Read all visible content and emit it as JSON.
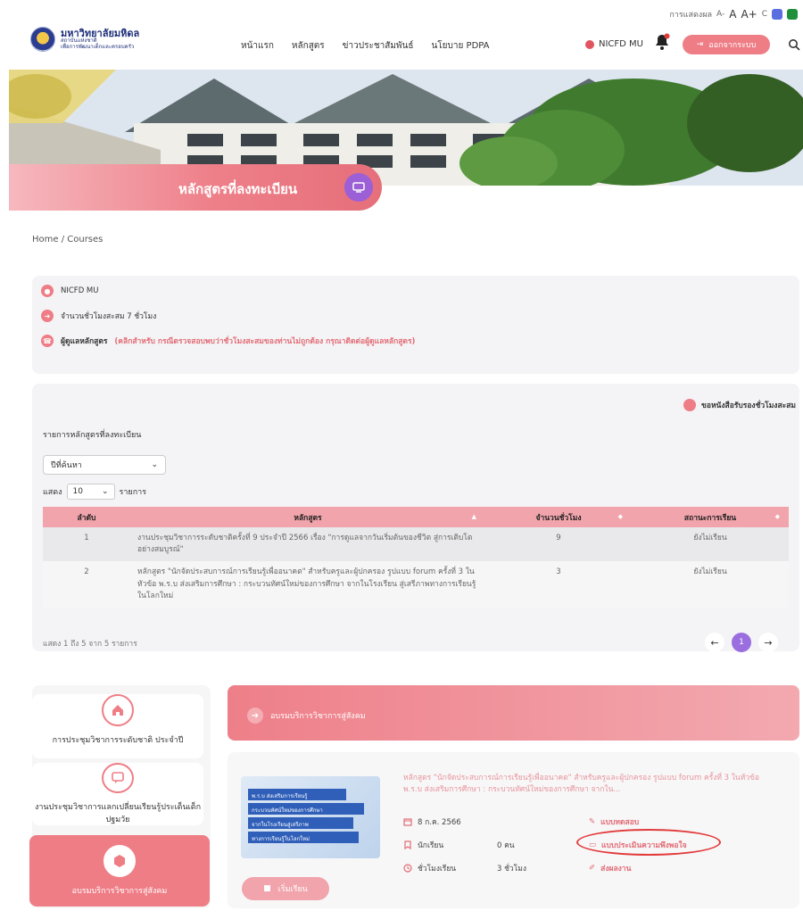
{
  "header": {
    "a11y": {
      "font_size_label": "การแสดงผล",
      "font_small": "A-",
      "font_normal": "A",
      "font_large": "A+",
      "contrast": "C"
    },
    "logo": {
      "main": "มหาวิทยาลัยมหิดล",
      "line1": "สถาบันแห่งชาติ",
      "line2": "เพื่อการพัฒนาเด็กและครอบครัว"
    },
    "nav": [
      "หน้าแรก",
      "หลักสูตร",
      "ข่าวประชาสัมพันธ์",
      "นโยบาย PDPA"
    ],
    "user": "NICFD MU",
    "logout": "ออกจากระบบ"
  },
  "banner": {
    "title": "หลักสูตรที่ลงทะเบียน"
  },
  "breadcrumb": "Home / Courses",
  "info": {
    "name": "NICFD MU",
    "hours": "จำนวนชั่วโมงสะสม 7 ชั่วโมง",
    "admin_label": "ผู้ดูแลหลักสูตร",
    "admin_note": "(คลิกสำหรับ กรณีตรวจสอบพบว่าชั่วโมงสะสมของท่านไม่ถูกต้อง กรุณาติดต่อผู้ดูแลหลักสูตร)"
  },
  "courses": {
    "cert_link": "ขอหนังสือรับรองชั่วโมงสะสม",
    "list_title": "รายการหลักสูตรที่ลงทะเบียน",
    "year_select": "ปีที่ค้นหา",
    "show_label": "แสดง",
    "show_value": "10",
    "show_suffix": "รายการ",
    "columns": [
      "ลำดับ",
      "หลักสูตร",
      "จำนวนชั่วโมง",
      "สถานะการเรียน"
    ],
    "rows": [
      {
        "no": "1",
        "title": "งานประชุมวิชาการระดับชาติครั้งที่ 9 ประจำปี 2566 เรื่อง \"การดูแลจากวันเริ่มต้นของชีวิต สู่การเติบโตอย่างสมบูรณ์\"",
        "hours": "9",
        "status": "ยังไม่เรียน"
      },
      {
        "no": "2",
        "title": "หลักสูตร \"นักจัดประสบการณ์การเรียนรู้เพื่ออนาคต\" สำหรับครูและผู้ปกครอง รูปแบบ forum ครั้งที่ 3 ในหัวข้อ พ.ร.บ ส่งเสริมการศึกษา : กระบวนทัศน์ใหม่ของการศึกษา จากในโรงเรียน สู่เสรีภาพทางการเรียนรู้ในโลกใหม่",
        "hours": "3",
        "status": "ยังไม่เรียน"
      }
    ],
    "summary": "แสดง 1 ถึง 5 จาก 5 รายการ",
    "page": "1"
  },
  "categories": [
    {
      "label": "การประชุมวิชาการระดับชาติ ประจำปี",
      "icon": "home-icon"
    },
    {
      "label": "งานประชุมวิชาการแลกเปลี่ยนเรียนรู้ประเด็นเด็กปฐมวัย",
      "icon": "chat-icon"
    },
    {
      "label": "อบรมบริการวิชาการสู่สังคม",
      "icon": "box-icon"
    }
  ],
  "section": {
    "title": "อบรมบริการวิชาการสู่สังคม"
  },
  "course_card": {
    "thumb_lines": [
      "พ.ร.บ ส่งเสริมการเรียนรู้",
      "กระบวนทัศน์ใหม่ของการศึกษา",
      "จากในโรงเรียนสู่เสรีภาพ",
      "ทางการเรียนรู้ในโลกใหม่"
    ],
    "description": "หลักสูตร \"นักจัดประสบการณ์การเรียนรู้เพื่ออนาคต\" สำหรับครูและผู้ปกครอง รูปแบบ forum ครั้งที่ 3 ในหัวข้อ พ.ร.บ ส่งเสริมการศึกษา : กระบวนทัศน์ใหม่ของการศึกษา จากใน...",
    "date": "8 ก.ค. 2566",
    "learners_label": "นักเรียน",
    "learners_value": "0 คน",
    "hours_label": "ชั่วโมงเรียน",
    "hours_value": "3 ชั่วโมง",
    "test": "แบบทดสอบ",
    "survey": "แบบประเมินความพึงพอใจ",
    "submit": "ส่งผลงาน",
    "start": "เริ่มเรียน"
  },
  "colors": {
    "accent": "#ef7d86",
    "purple": "#9b6ee0",
    "highlight_oval": "#e23b3b"
  }
}
